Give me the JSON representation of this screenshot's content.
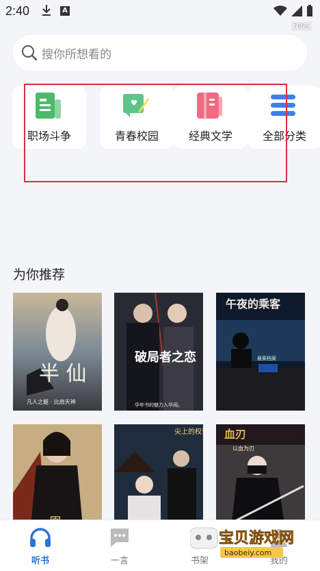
{
  "status_bar": {
    "time": "2:40",
    "badge": "A",
    "corner_tag": "7ehc"
  },
  "search": {
    "placeholder": "搜你所想看的"
  },
  "categories": [
    {
      "label": "职场斗争",
      "icon": "book-green-icon",
      "color": "#4cba6b"
    },
    {
      "label": "青春校园",
      "icon": "heart-notebook-icon",
      "color": "#5dc48a"
    },
    {
      "label": "经典文学",
      "icon": "pink-book-icon",
      "color": "#f06b82"
    },
    {
      "label": "全部分类",
      "icon": "list-icon",
      "color": "#3f80e4"
    }
  ],
  "recommend": {
    "title": "为你推荐",
    "books": [
      {
        "cover_title": "半 仙",
        "subtitle": "凡人之躯 · 比肩天神"
      },
      {
        "cover_title": "破局者之恋",
        "subtitle": "华年书的魅力入华阀。"
      },
      {
        "cover_title": "午夜的乘客",
        "subtitle": "悬案档案"
      },
      {
        "cover_title": "凰",
        "subtitle": ""
      },
      {
        "cover_title": "尖上的权谋",
        "subtitle": ""
      },
      {
        "cover_title": "血刃",
        "subtitle": "以血为刃"
      }
    ]
  },
  "bottom_nav": [
    {
      "label": "听书",
      "icon": "headphones-icon",
      "active": true
    },
    {
      "label": "一言",
      "icon": "chat-bubble-icon",
      "active": false
    },
    {
      "label": "书架",
      "icon": "bookshelf-icon",
      "active": false
    },
    {
      "label": "我的",
      "icon": "profile-icon",
      "active": false
    }
  ],
  "watermark": {
    "text": "宝贝游戏网",
    "url": "baobeiy.com"
  },
  "colors": {
    "accent": "#2a73d9",
    "highlight": "#d6303c"
  }
}
